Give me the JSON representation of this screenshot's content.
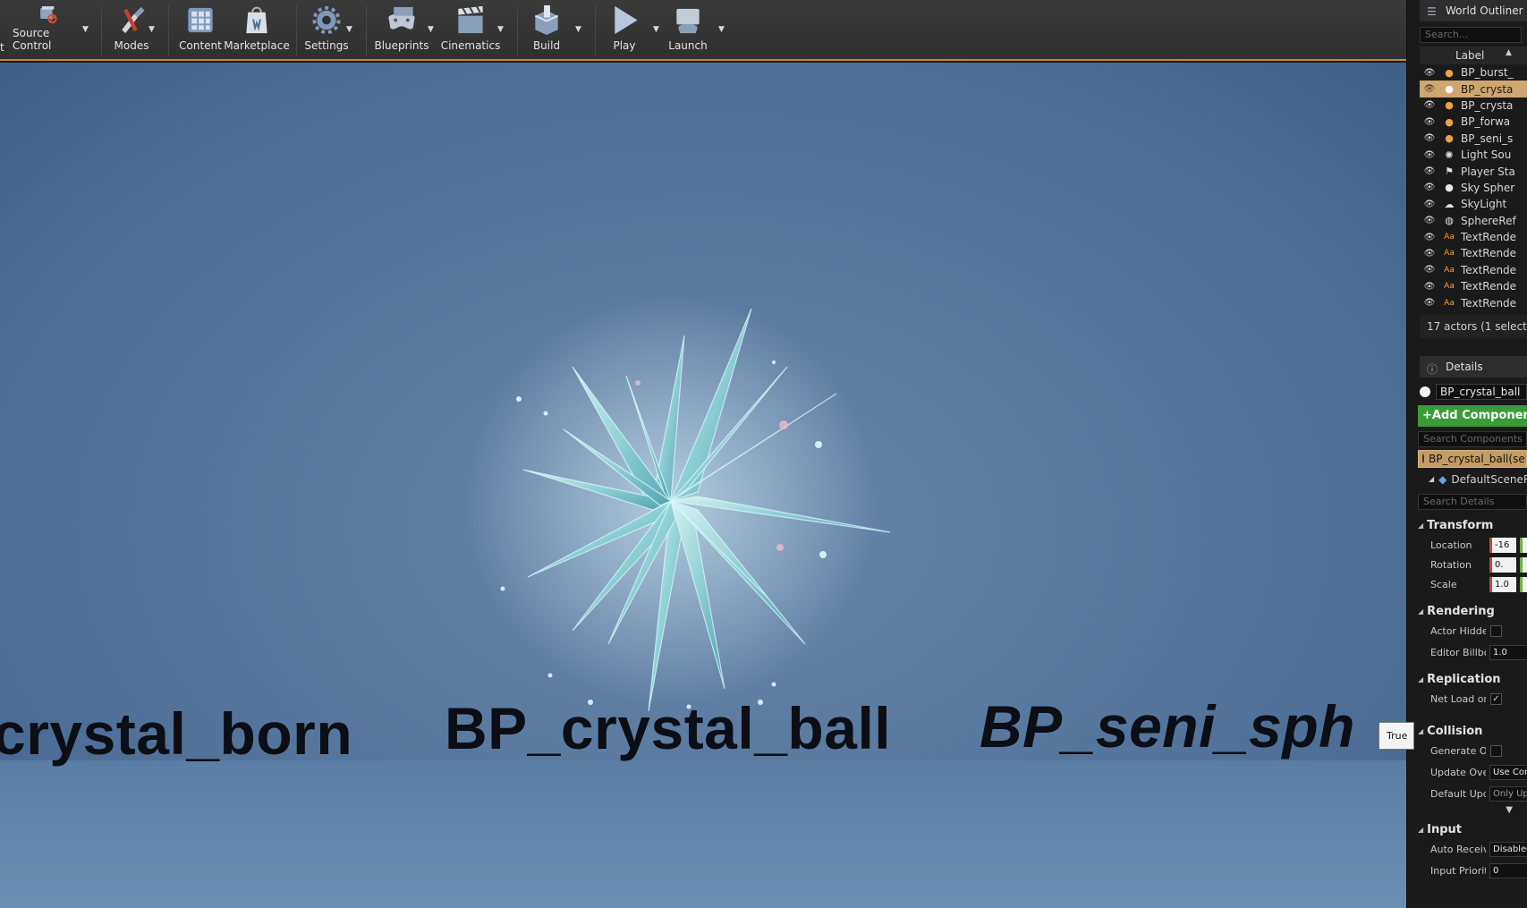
{
  "toolbar": {
    "clipped_label": "t",
    "buttons": [
      {
        "label": "Source Control",
        "icon": "source-control-icon"
      },
      {
        "label": "Modes",
        "icon": "modes-icon"
      },
      {
        "label": "Content",
        "icon": "content-icon"
      },
      {
        "label": "Marketplace",
        "icon": "marketplace-icon"
      },
      {
        "label": "Settings",
        "icon": "settings-icon"
      },
      {
        "label": "Blueprints",
        "icon": "blueprints-icon"
      },
      {
        "label": "Cinematics",
        "icon": "cinematics-icon"
      },
      {
        "label": "Build",
        "icon": "build-icon"
      },
      {
        "label": "Play",
        "icon": "play-icon"
      },
      {
        "label": "Launch",
        "icon": "launch-icon"
      }
    ],
    "accent_color": "#c58a2c"
  },
  "viewport": {
    "labels": [
      "crystal_born",
      "BP_crystal_ball",
      "BP_seni_sph"
    ]
  },
  "outliner": {
    "title": "World Outliner",
    "search_placeholder": "Search...",
    "column_label": "Label",
    "items": [
      {
        "label": "BP_burst_",
        "icon": "actor-sphere-icon",
        "selected": false
      },
      {
        "label": "BP_crysta",
        "icon": "actor-sphere-icon",
        "selected": true
      },
      {
        "label": "BP_crysta",
        "icon": "actor-sphere-icon",
        "selected": false
      },
      {
        "label": "BP_forwa",
        "icon": "actor-sphere-icon",
        "selected": false
      },
      {
        "label": "BP_seni_s",
        "icon": "actor-sphere-icon",
        "selected": false
      },
      {
        "label": "Light Sou",
        "icon": "light-icon",
        "selected": false
      },
      {
        "label": "Player Sta",
        "icon": "player-start-icon",
        "selected": false
      },
      {
        "label": "Sky Spher",
        "icon": "sphere-icon",
        "selected": false
      },
      {
        "label": "SkyLight",
        "icon": "skylight-icon",
        "selected": false
      },
      {
        "label": "SphereRef",
        "icon": "sphere-reflection-icon",
        "selected": false
      },
      {
        "label": "TextRende",
        "icon": "text-render-icon",
        "selected": false
      },
      {
        "label": "TextRende",
        "icon": "text-render-icon",
        "selected": false
      },
      {
        "label": "TextRende",
        "icon": "text-render-icon",
        "selected": false
      },
      {
        "label": "TextRende",
        "icon": "text-render-icon",
        "selected": false
      },
      {
        "label": "TextRende",
        "icon": "text-render-icon",
        "selected": false
      }
    ],
    "footer": "17 actors (1 selecte"
  },
  "details": {
    "title": "Details",
    "actor_name": "BP_crystal_ball",
    "add_component_label": "Add Component",
    "search_components_placeholder": "Search Components",
    "self_component": "BP_crystal_ball(self",
    "child_component": "DefaultSceneRo",
    "search_details_placeholder": "Search Details",
    "sections": {
      "transform": "Transform",
      "rendering": "Rendering",
      "replication": "Replication",
      "collision": "Collision",
      "input": "Input"
    },
    "props": {
      "location_label": "Location",
      "location_x": "-16",
      "rotation_label": "Rotation",
      "rotation_x": "0.",
      "scale_label": "Scale",
      "scale_x": "1.0",
      "actor_hidden_label": "Actor Hidden",
      "editor_billboard_label": "Editor Billboa",
      "editor_billboard_value": "1.0",
      "net_load_label": "Net Load on",
      "net_load_tooltip": "True",
      "generate_overlap_label": "Generate Ov",
      "update_overlaps_label": "Update Over",
      "update_overlaps_value": "Use Con",
      "default_update_label": "Default Upda",
      "default_update_value": "Only Up",
      "auto_receive_label": "Auto Receiv",
      "auto_receive_value": "Disabled",
      "input_priority_label": "Input Priority",
      "input_priority_value": "0"
    }
  }
}
